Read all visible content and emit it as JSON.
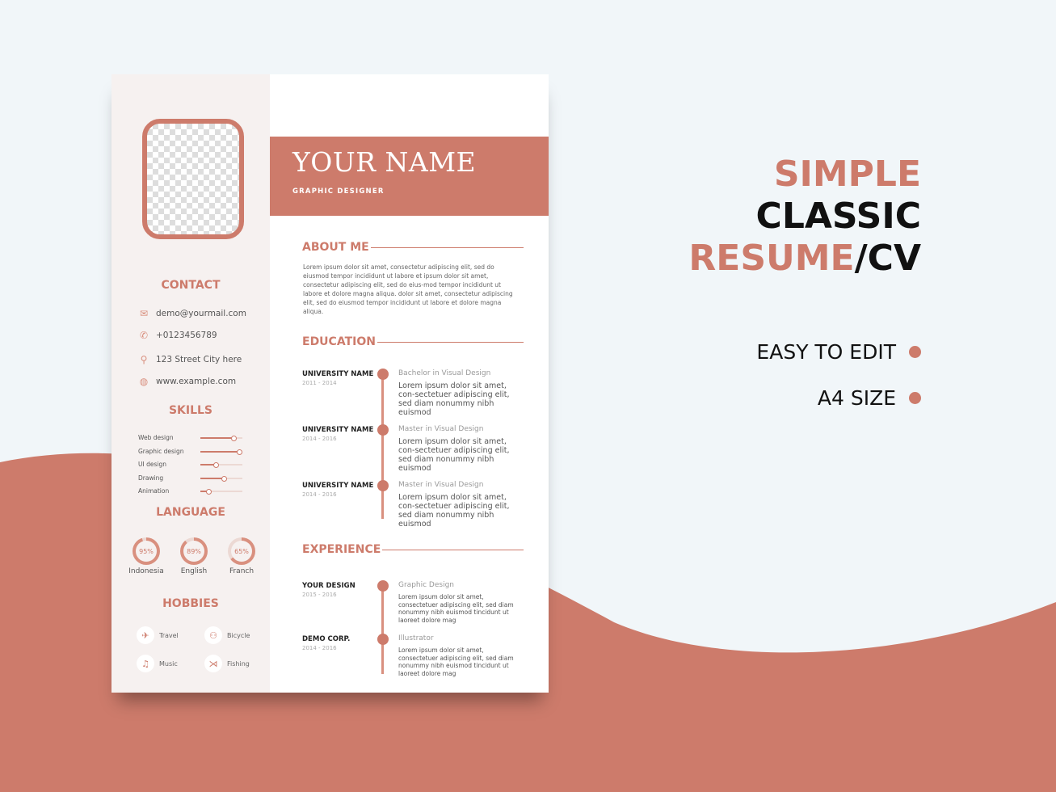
{
  "colors": {
    "accent": "#cd7b6b",
    "background": "#f1f6f9",
    "sidebar": "#f6f1f0"
  },
  "resume": {
    "name": "YOUR NAME",
    "job_title": "GRAPHIC DESIGNER",
    "contact": {
      "heading": "CONTACT",
      "items": [
        {
          "icon": "mail-icon",
          "text": "demo@yourmail.com"
        },
        {
          "icon": "phone-icon",
          "text": "+0123456789"
        },
        {
          "icon": "location-icon",
          "text": "123 Street City here"
        },
        {
          "icon": "globe-icon",
          "text": "www.example.com"
        }
      ]
    },
    "skills": {
      "heading": "SKILLS",
      "items": [
        {
          "label": "Web design",
          "level": 0.8
        },
        {
          "label": "Graphic design",
          "level": 0.95
        },
        {
          "label": "UI design",
          "level": 0.38
        },
        {
          "label": "Drawing",
          "level": 0.58
        },
        {
          "label": "Animation",
          "level": 0.22
        }
      ]
    },
    "language": {
      "heading": "LANGUAGE",
      "items": [
        {
          "pct": "95%",
          "value": 95,
          "label": "Indonesia"
        },
        {
          "pct": "89%",
          "value": 89,
          "label": "English"
        },
        {
          "pct": "65%",
          "value": 65,
          "label": "Franch"
        }
      ]
    },
    "hobbies": {
      "heading": "HOBBIES",
      "items": [
        {
          "icon": "plane-icon",
          "label": "Travel"
        },
        {
          "icon": "bicycle-icon",
          "label": "Bicycle"
        },
        {
          "icon": "music-icon",
          "label": "Music"
        },
        {
          "icon": "fish-icon",
          "label": "Fishing"
        }
      ]
    },
    "about": {
      "heading": "ABOUT ME",
      "text": "Lorem ipsum dolor sit amet, consectetur adipiscing elit, sed do eiusmod tempor incididunt ut labore et ipsum dolor sit amet, consectetur adipiscing elit, sed do eius-mod tempor incididunt ut labore et dolore magna aliqua. dolor sit amet, consectetur adipiscing elit, sed do eiusmod tempor incididunt ut labore et dolore magna aliqua."
    },
    "education": {
      "heading": "EDUCATION",
      "items": [
        {
          "org": "UNIVERSITY NAME",
          "years": "2011 - 2014",
          "degree": "Bachelor in Visual Design",
          "desc": "Lorem ipsum dolor sit amet, con-sectetuer adipiscing elit, sed diam nonummy nibh euismod"
        },
        {
          "org": "UNIVERSITY NAME",
          "years": "2014 - 2016",
          "degree": "Master in Visual Design",
          "desc": "Lorem ipsum dolor sit amet, con-sectetuer adipiscing elit, sed diam nonummy nibh euismod"
        },
        {
          "org": "UNIVERSITY NAME",
          "years": "2014 - 2016",
          "degree": "Master in Visual Design",
          "desc": "Lorem ipsum dolor sit amet, con-sectetuer adipiscing elit, sed diam nonummy nibh euismod"
        }
      ]
    },
    "experience": {
      "heading": "EXPERIENCE",
      "items": [
        {
          "org": "YOUR DESIGN",
          "years": "2015 - 2016",
          "role": "Graphic Design",
          "desc": "Lorem ipsum dolor sit amet, consectetuer adipiscing elit, sed diam nonummy nibh euismod tincidunt ut laoreet dolore mag"
        },
        {
          "org": "DEMO CORP.",
          "years": "2014 - 2016",
          "role": "Illustrator",
          "desc": "Lorem ipsum dolor sit amet, consectetuer adipiscing elit, sed diam nonummy nibh euismod tincidunt ut laoreet dolore mag"
        }
      ]
    }
  },
  "promo": {
    "line1": "SIMPLE",
    "line2": "CLASSIC",
    "line3a": "RESUME",
    "line3b": "/CV",
    "features": [
      "EASY TO EDIT",
      "A4 SIZE"
    ]
  }
}
